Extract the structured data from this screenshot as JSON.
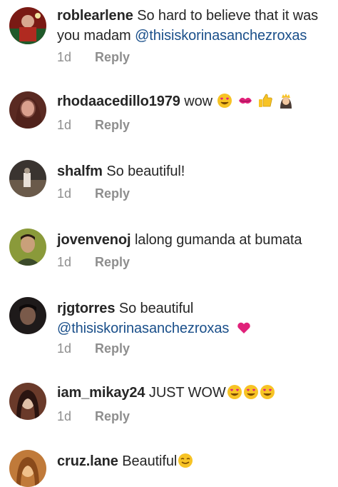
{
  "comments": [
    {
      "username": "roblearlene",
      "text": "So hard to believe that it was you madam",
      "mention": "@thisiskorinasanchezroxas",
      "time": "1d",
      "reply": "Reply",
      "avatar_colors": [
        "#7a1a14",
        "#1f5a2a"
      ]
    },
    {
      "username": "rhodaacedillo1979",
      "text": "wow",
      "emojis": [
        "smiling-face-heart-eyes",
        "kiss-mark",
        "thumbs-up",
        "woman-with-crown"
      ],
      "time": "1d",
      "reply": "Reply",
      "avatar_colors": [
        "#5a2a22",
        "#c98a7a"
      ]
    },
    {
      "username": "shalfm",
      "text": "So beautiful!",
      "time": "1d",
      "reply": "Reply",
      "avatar_colors": [
        "#3a3430",
        "#a89a8a"
      ]
    },
    {
      "username": "jovenvenoj",
      "text": "lalong gumanda at bumata",
      "time": "1d",
      "reply": "Reply",
      "avatar_colors": [
        "#8a9a3a",
        "#3b4a2a"
      ]
    },
    {
      "username": "rjgtorres",
      "text": "So beautiful",
      "mention": "@thisiskorinasanchezroxas",
      "emojis": [
        "purple-heart"
      ],
      "time": "1d",
      "reply": "Reply",
      "avatar_colors": [
        "#1e1a1a",
        "#7a5a4a"
      ]
    },
    {
      "username": "iam_mikay24",
      "text": "JUST WOW",
      "emojis": [
        "smiling-face-heart-eyes",
        "smiling-face-heart-eyes",
        "smiling-face-heart-eyes"
      ],
      "time": "1d",
      "reply": "Reply",
      "avatar_colors": [
        "#6a3a2a",
        "#e0c0a8"
      ]
    },
    {
      "username": "cruz.lane",
      "text": "Beautiful",
      "emojis": [
        "smiling-face"
      ],
      "avatar_colors": [
        "#c07a3a",
        "#f0c08a"
      ]
    }
  ],
  "colors": {
    "username": "#262626",
    "mention": "#1a4f8a",
    "meta": "#8e8e8e",
    "emoji_yellow": "#f7c325",
    "heart_pink": "#e0217a"
  }
}
